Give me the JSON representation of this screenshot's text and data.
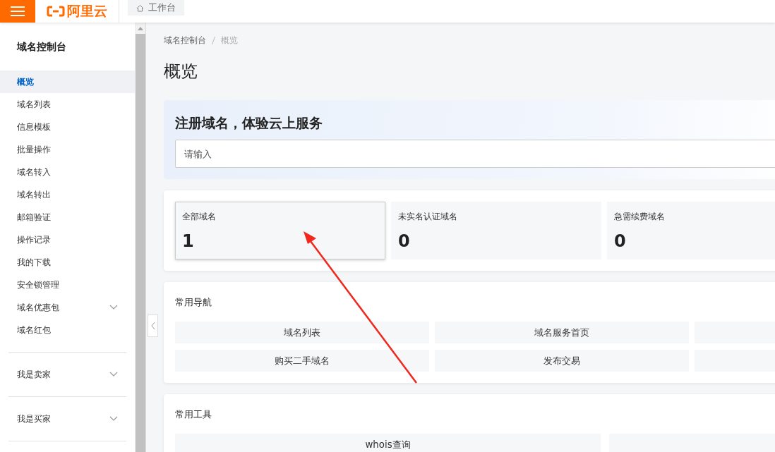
{
  "header": {
    "logo": "阿里云",
    "tab": "工作台"
  },
  "sidebar": {
    "title": "域名控制台",
    "items": [
      {
        "label": "概览",
        "selected": true,
        "expandable": false
      },
      {
        "label": "域名列表",
        "selected": false,
        "expandable": false
      },
      {
        "label": "信息模板",
        "selected": false,
        "expandable": false
      },
      {
        "label": "批量操作",
        "selected": false,
        "expandable": false
      },
      {
        "label": "域名转入",
        "selected": false,
        "expandable": false
      },
      {
        "label": "域名转出",
        "selected": false,
        "expandable": false
      },
      {
        "label": "邮箱验证",
        "selected": false,
        "expandable": false
      },
      {
        "label": "操作记录",
        "selected": false,
        "expandable": false
      },
      {
        "label": "我的下载",
        "selected": false,
        "expandable": false
      },
      {
        "label": "安全锁管理",
        "selected": false,
        "expandable": false
      },
      {
        "label": "域名优惠包",
        "selected": false,
        "expandable": true
      },
      {
        "label": "域名红包",
        "selected": false,
        "expandable": false
      }
    ],
    "groups": [
      {
        "label": "我是卖家",
        "expanded": false
      },
      {
        "label": "我是买家",
        "expanded": false
      }
    ]
  },
  "breadcrumb": [
    "域名控制台",
    "概览"
  ],
  "page_title": "概览",
  "search_banner": {
    "title": "注册域名，体验云上服务",
    "placeholder": "请输入"
  },
  "stats": [
    {
      "label": "全部域名",
      "value": "1",
      "selected": true
    },
    {
      "label": "未实名认证域名",
      "value": "0",
      "selected": false
    },
    {
      "label": "急需续费域名",
      "value": "0",
      "selected": false
    }
  ],
  "navigation": {
    "title": "常用导航",
    "items": [
      "域名列表",
      "域名服务首页",
      "购买二手域名",
      "发布交易"
    ]
  },
  "tools": {
    "title": "常用工具",
    "items": [
      "whois查询"
    ]
  }
}
